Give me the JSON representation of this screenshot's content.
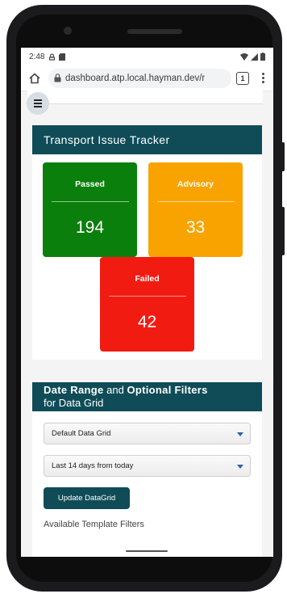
{
  "status_bar": {
    "time": "2:48"
  },
  "browser": {
    "url": "dashboard.atp.local.hayman.dev/r",
    "tab_count": "1"
  },
  "tracker": {
    "title": "Transport Issue Tracker",
    "cards": [
      {
        "label": "Passed",
        "value": "194",
        "color": "#0b7f0b"
      },
      {
        "label": "Advisory",
        "value": "33",
        "color": "#f9a300"
      },
      {
        "label": "Failed",
        "value": "42",
        "color": "#f21b12"
      }
    ]
  },
  "filters": {
    "title_bold_1": "Date Range",
    "title_mid": "and",
    "title_bold_2": "Optional Filters",
    "title_line2": "for Data Grid",
    "grid_select": "Default Data Grid",
    "range_select": "Last 14 days from today",
    "update_button": "Update DataGrid",
    "templates_label": "Available Template Filters"
  },
  "colors": {
    "header_bg": "#0f4c57",
    "page_bg": "#f4f4f4"
  }
}
